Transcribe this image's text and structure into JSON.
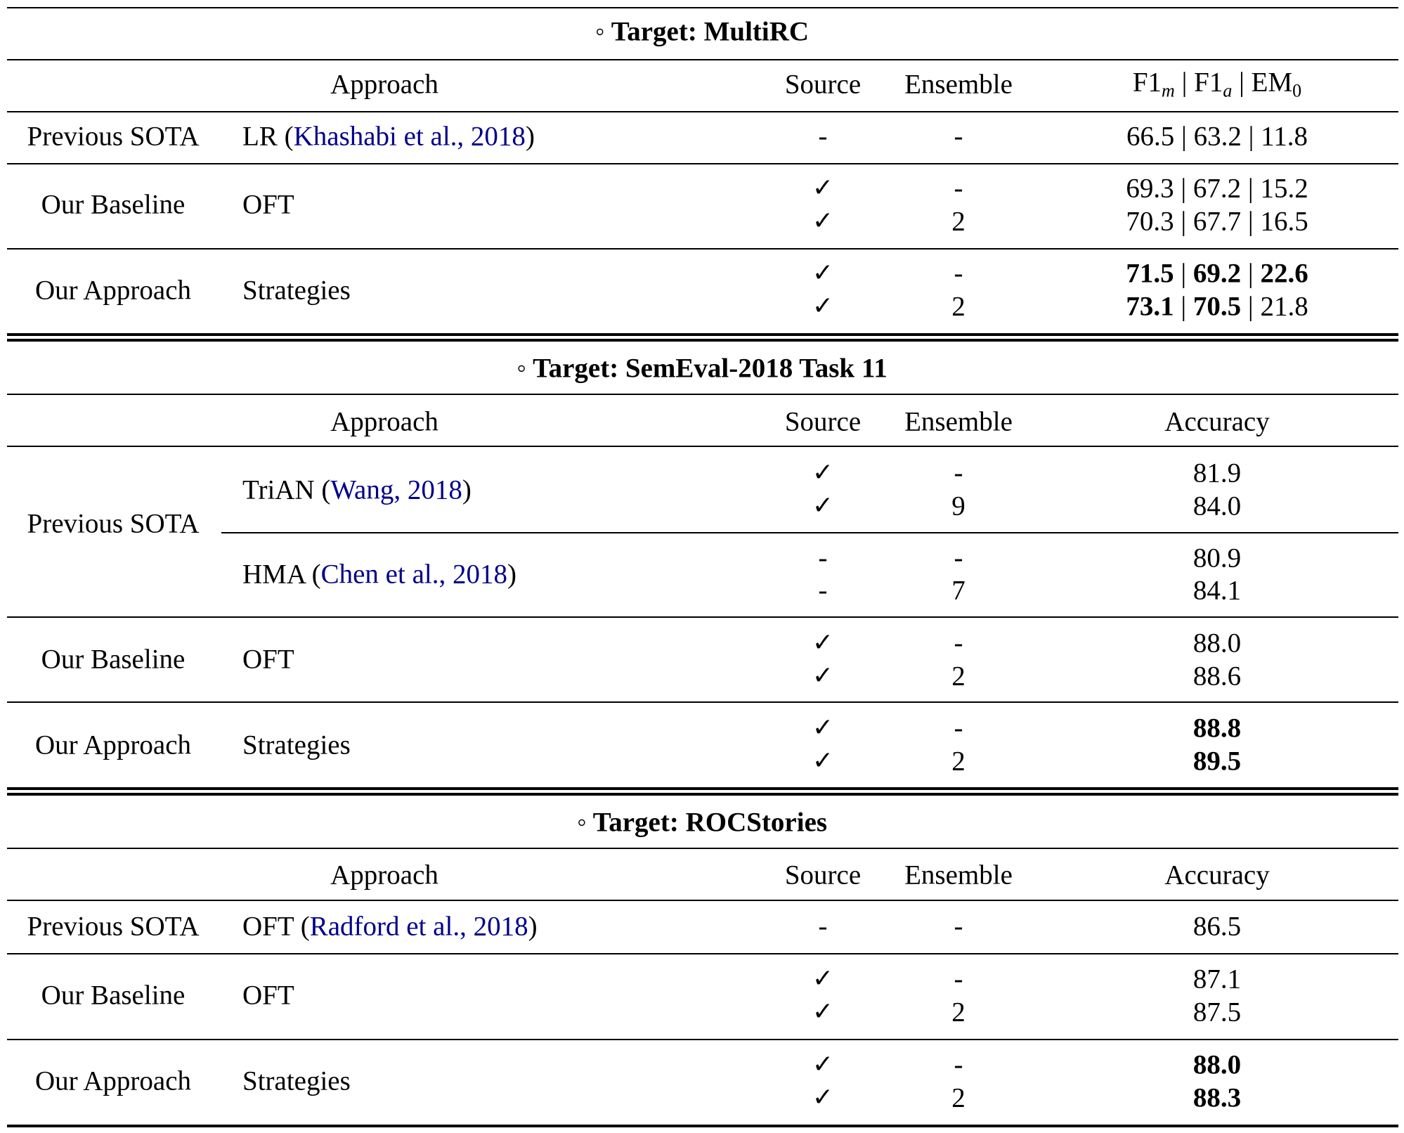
{
  "sections": [
    {
      "title": "◦ Target: MultiRC",
      "header": {
        "approach": "Approach",
        "source": "Source",
        "ensemble": "Ensemble",
        "metric": "F1m | F1a | EM0",
        "metric_parts": {
          "a": "F1",
          "a_sub": "m",
          "b": "F1",
          "b_sub": "a",
          "c": "EM",
          "c_sub": "0"
        }
      },
      "rows": [
        {
          "group": "Previous SOTA",
          "method": "LR",
          "citation": "Khashabi et al., 2018",
          "source": "-",
          "ensemble": "-",
          "metric": [
            {
              "v": "66.5",
              "bold": false
            },
            {
              "v": "63.2",
              "bold": false
            },
            {
              "v": "11.8",
              "bold": false
            }
          ]
        },
        {
          "group": "Our Baseline",
          "method": "OFT",
          "source": "✓",
          "ensemble": "-",
          "metric": [
            {
              "v": "69.3",
              "bold": false
            },
            {
              "v": "67.2",
              "bold": false
            },
            {
              "v": "15.2",
              "bold": false
            }
          ]
        },
        {
          "group": "",
          "method": "",
          "source": "✓",
          "ensemble": "2",
          "metric": [
            {
              "v": "70.3",
              "bold": false
            },
            {
              "v": "67.7",
              "bold": false
            },
            {
              "v": "16.5",
              "bold": false
            }
          ]
        },
        {
          "group": "Our Approach",
          "method": "Strategies",
          "source": "✓",
          "ensemble": "-",
          "metric": [
            {
              "v": "71.5",
              "bold": true
            },
            {
              "v": "69.2",
              "bold": true
            },
            {
              "v": "22.6",
              "bold": true
            }
          ]
        },
        {
          "group": "",
          "method": "",
          "source": "✓",
          "ensemble": "2",
          "metric": [
            {
              "v": "73.1",
              "bold": true
            },
            {
              "v": "70.5",
              "bold": true
            },
            {
              "v": "21.8",
              "bold": false
            }
          ]
        }
      ]
    },
    {
      "title": "◦ Target: SemEval-2018 Task 11",
      "header": {
        "approach": "Approach",
        "source": "Source",
        "ensemble": "Ensemble",
        "metric": "Accuracy"
      },
      "rows": [
        {
          "group": "Previous SOTA",
          "method": "TriAN",
          "citation": "Wang, 2018",
          "source": "✓",
          "ensemble": "-",
          "metric": "81.9",
          "bold": false
        },
        {
          "group": "",
          "method": "",
          "source": "✓",
          "ensemble": "9",
          "metric": "84.0",
          "bold": false
        },
        {
          "group": "",
          "method": "HMA",
          "citation": "Chen et al., 2018",
          "source": "-",
          "ensemble": "-",
          "metric": "80.9",
          "bold": false
        },
        {
          "group": "",
          "method": "",
          "source": "-",
          "ensemble": "7",
          "metric": "84.1",
          "bold": false
        },
        {
          "group": "Our Baseline",
          "method": "OFT",
          "source": "✓",
          "ensemble": "-",
          "metric": "88.0",
          "bold": false
        },
        {
          "group": "",
          "method": "",
          "source": "✓",
          "ensemble": "2",
          "metric": "88.6",
          "bold": false
        },
        {
          "group": "Our Approach",
          "method": "Strategies",
          "source": "✓",
          "ensemble": "-",
          "metric": "88.8",
          "bold": true
        },
        {
          "group": "",
          "method": "",
          "source": "✓",
          "ensemble": "2",
          "metric": "89.5",
          "bold": true
        }
      ]
    },
    {
      "title": "◦ Target: ROCStories",
      "header": {
        "approach": "Approach",
        "source": "Source",
        "ensemble": "Ensemble",
        "metric": "Accuracy"
      },
      "rows": [
        {
          "group": "Previous SOTA",
          "method": "OFT",
          "citation": "Radford et al., 2018",
          "source": "-",
          "ensemble": "-",
          "metric": "86.5",
          "bold": false
        },
        {
          "group": "Our Baseline",
          "method": "OFT",
          "source": "✓",
          "ensemble": "-",
          "metric": "87.1",
          "bold": false
        },
        {
          "group": "",
          "method": "",
          "source": "✓",
          "ensemble": "2",
          "metric": "87.5",
          "bold": false
        },
        {
          "group": "Our Approach",
          "method": "Strategies",
          "source": "✓",
          "ensemble": "-",
          "metric": "88.0",
          "bold": true
        },
        {
          "group": "",
          "method": "",
          "source": "✓",
          "ensemble": "2",
          "metric": "88.3",
          "bold": true
        }
      ]
    }
  ]
}
